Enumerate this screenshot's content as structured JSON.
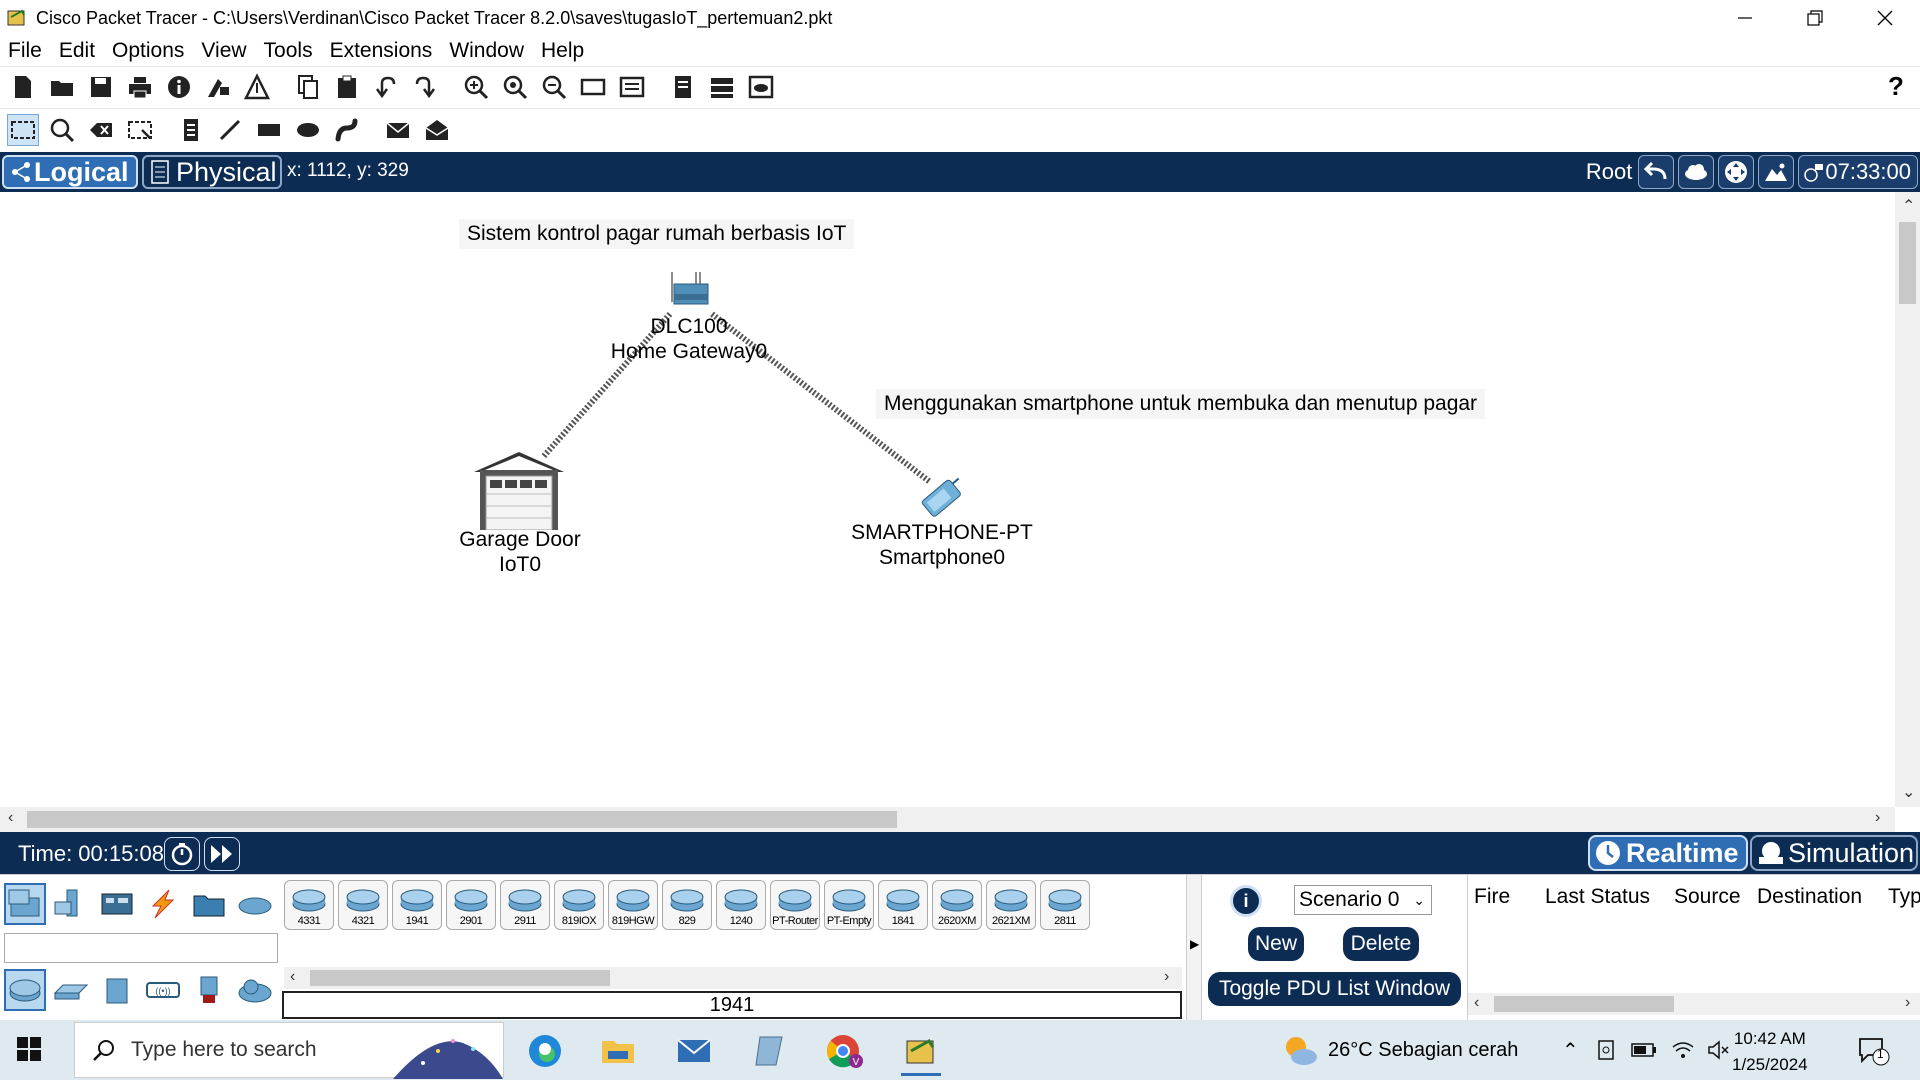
{
  "window": {
    "title": "Cisco Packet Tracer - C:\\Users\\Verdinan\\Cisco Packet Tracer 8.2.0\\saves\\tugasIoT_pertemuan2.pkt"
  },
  "menu": [
    "File",
    "Edit",
    "Options",
    "View",
    "Tools",
    "Extensions",
    "Window",
    "Help"
  ],
  "toolbar": {
    "help": "?"
  },
  "workspace": {
    "logical_tab": "Logical",
    "physical_tab": "Physical",
    "coords": "x: 1112, y: 329",
    "root_label": "Root",
    "clock": "07:33:00"
  },
  "canvas": {
    "notes": [
      "Sistem kontrol pagar rumah berbasis IoT",
      "Menggunakan smartphone untuk membuka dan menutup pagar"
    ],
    "devices": [
      {
        "line1": "DLC100",
        "line2": "Home Gateway0"
      },
      {
        "line1": "Garage Door",
        "line2": "IoT0"
      },
      {
        "line1": "SMARTPHONE-PT",
        "line2": "Smartphone0"
      }
    ]
  },
  "timebar": {
    "time": "Time: 00:15:08",
    "realtime": "Realtime",
    "simulation": "Simulation"
  },
  "devices_panel": {
    "models": [
      "4331",
      "4321",
      "1941",
      "2901",
      "2911",
      "819IOX",
      "819HGW",
      "829",
      "1240",
      "PT-Router",
      "PT-Empty",
      "1841",
      "2620XM",
      "2621XM",
      "2811"
    ],
    "selected_model": "1941"
  },
  "scenario": {
    "info": "i",
    "selected": "Scenario 0",
    "new": "New",
    "delete": "Delete",
    "toggle": "Toggle PDU List Window"
  },
  "pdu_columns": [
    "Fire",
    "Last Status",
    "Source",
    "Destination",
    "Typ"
  ],
  "taskbar": {
    "search_placeholder": "Type here to search",
    "weather": "26°C  Sebagian cerah",
    "time": "10:42 AM",
    "date": "1/25/2024",
    "notifications": "1"
  }
}
